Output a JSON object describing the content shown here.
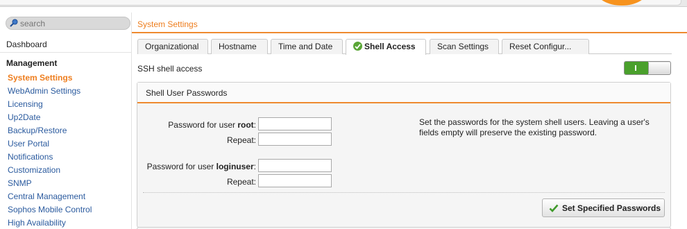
{
  "search": {
    "placeholder": "search"
  },
  "sidebar": {
    "dashboard": "Dashboard",
    "section": "Management",
    "items": [
      {
        "label": "System Settings",
        "active": true
      },
      {
        "label": "WebAdmin Settings"
      },
      {
        "label": "Licensing"
      },
      {
        "label": "Up2Date"
      },
      {
        "label": "Backup/Restore"
      },
      {
        "label": "User Portal"
      },
      {
        "label": "Notifications"
      },
      {
        "label": "Customization"
      },
      {
        "label": "SNMP"
      },
      {
        "label": "Central Management"
      },
      {
        "label": "Sophos Mobile Control"
      },
      {
        "label": "High Availability"
      }
    ]
  },
  "breadcrumb": "System Settings",
  "tabs": [
    {
      "label": "Organizational"
    },
    {
      "label": "Hostname"
    },
    {
      "label": "Time and Date"
    },
    {
      "label": "Shell Access",
      "active": true
    },
    {
      "label": "Scan Settings"
    },
    {
      "label": "Reset Configur..."
    }
  ],
  "ssh": {
    "label": "SSH shell access",
    "enabled": true
  },
  "panel": {
    "title": "Shell User Passwords",
    "root_label_prefix": "Password for user ",
    "root_user": "root",
    "loginuser_user": "loginuser",
    "colon": ":",
    "repeat_label": "Repeat:",
    "help_text": "Set the passwords for the system shell users. Leaving a user's fields empty will preserve the existing password.",
    "button_label": "Set Specified Passwords"
  },
  "colors": {
    "accent": "#ee7d1d",
    "link": "#2a5a9e",
    "success": "#4aa02c"
  },
  "icons": {
    "search": "magnifier-icon",
    "tab_status": "check-circle-icon",
    "button": "checkmark-icon"
  }
}
